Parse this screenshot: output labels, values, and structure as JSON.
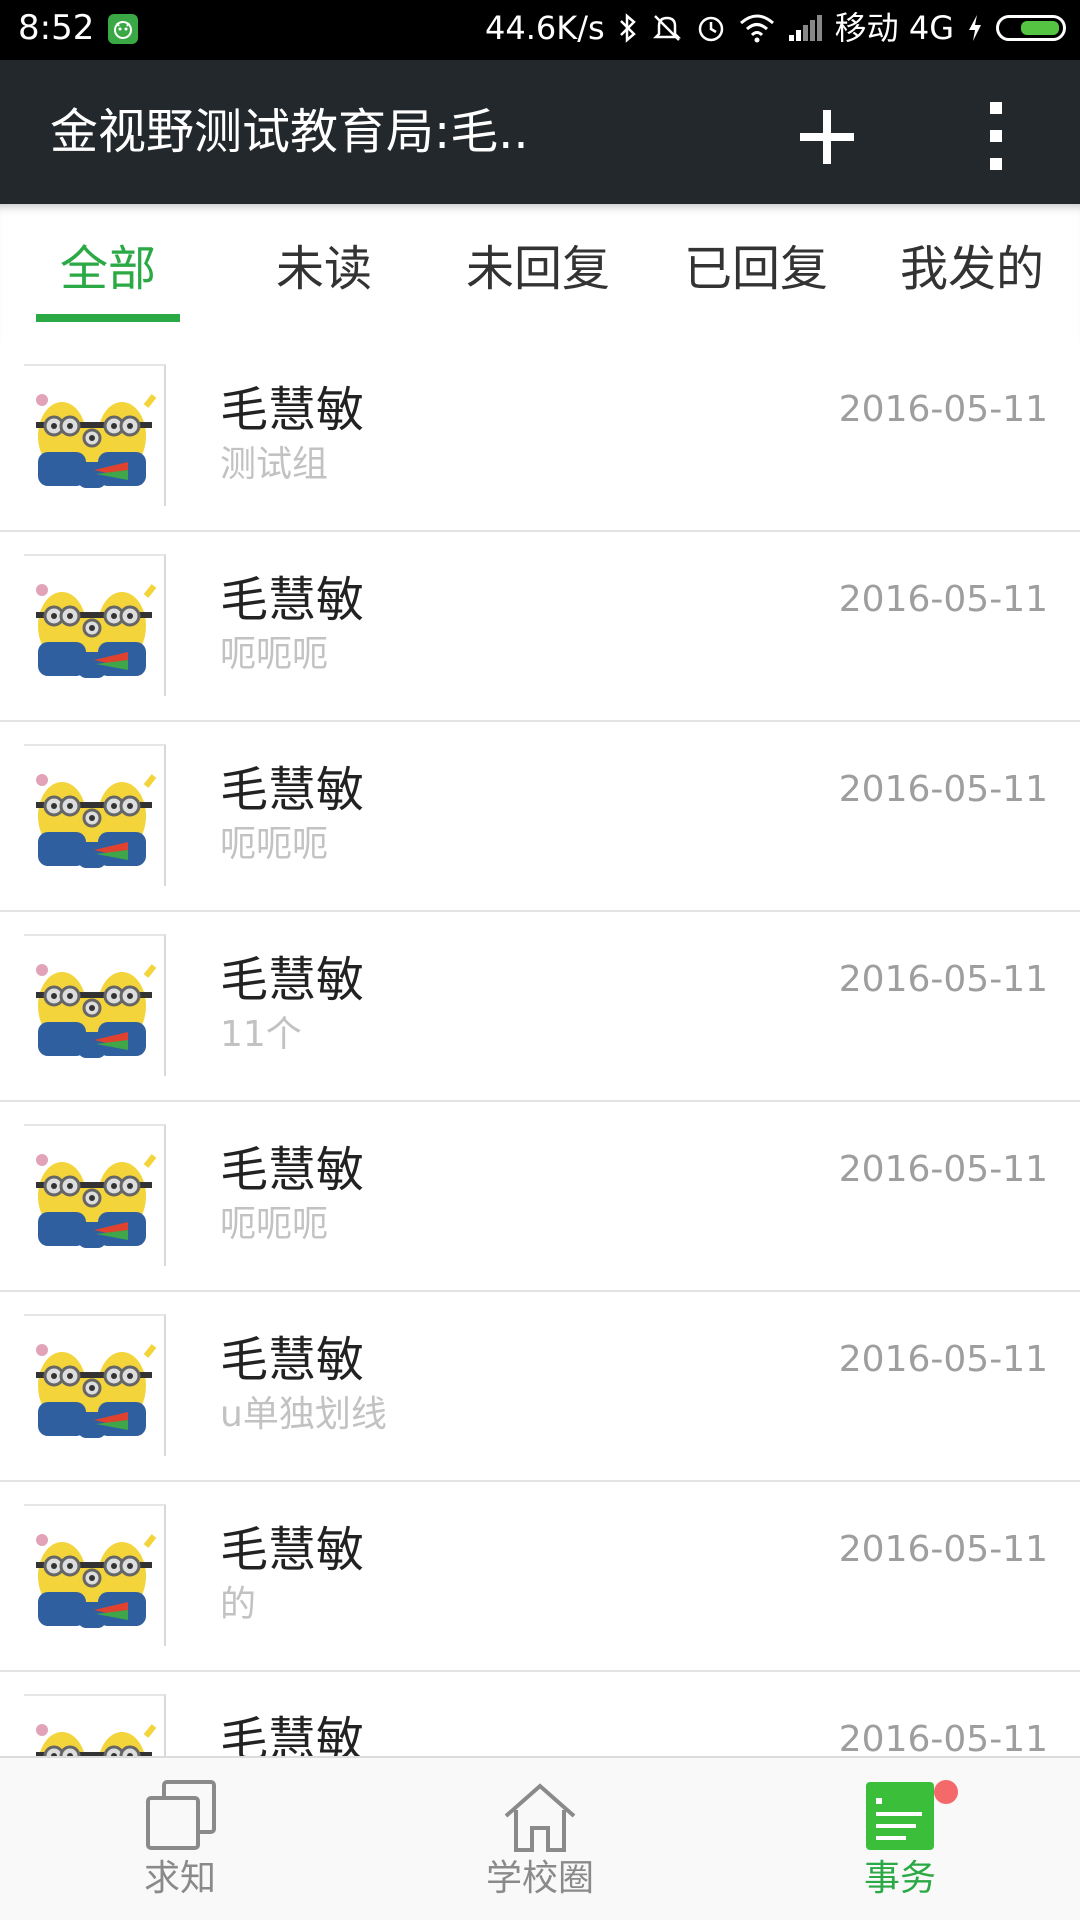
{
  "status_bar": {
    "time": "8:52",
    "speed": "44.6K/s",
    "carrier": "移动 4G",
    "icons": [
      "app-notification-icon",
      "bluetooth-icon",
      "mute-icon",
      "alarm-icon",
      "wifi-icon",
      "signal-icon",
      "charging-icon",
      "battery-icon"
    ]
  },
  "app_bar": {
    "title": "金视野测试教育局:毛..",
    "add_icon": "plus-icon",
    "more_icon": "overflow-menu-icon"
  },
  "tabs": [
    {
      "label": "全部",
      "active": true
    },
    {
      "label": "未读",
      "active": false
    },
    {
      "label": "未回复",
      "active": false
    },
    {
      "label": "已回复",
      "active": false
    },
    {
      "label": "我发的",
      "active": false
    }
  ],
  "accent_color": "#2aa944",
  "messages": [
    {
      "name": "毛慧敏",
      "message": "测试组",
      "date": "2016-05-11"
    },
    {
      "name": "毛慧敏",
      "message": "呃呃呃",
      "date": "2016-05-11"
    },
    {
      "name": "毛慧敏",
      "message": "呃呃呃",
      "date": "2016-05-11"
    },
    {
      "name": "毛慧敏",
      "message": "11个",
      "date": "2016-05-11"
    },
    {
      "name": "毛慧敏",
      "message": "呃呃呃",
      "date": "2016-05-11"
    },
    {
      "name": "毛慧敏",
      "message": "u单独划线",
      "date": "2016-05-11"
    },
    {
      "name": "毛慧敏",
      "message": "的",
      "date": "2016-05-11"
    },
    {
      "name": "毛慧敏",
      "message": "",
      "date": "2016-05-11"
    }
  ],
  "bottom_nav": [
    {
      "label": "求知",
      "icon": "copy-squares-icon",
      "active": false
    },
    {
      "label": "学校圈",
      "icon": "home-icon",
      "active": false
    },
    {
      "label": "事务",
      "icon": "document-list-icon",
      "active": true,
      "badge": true
    }
  ]
}
